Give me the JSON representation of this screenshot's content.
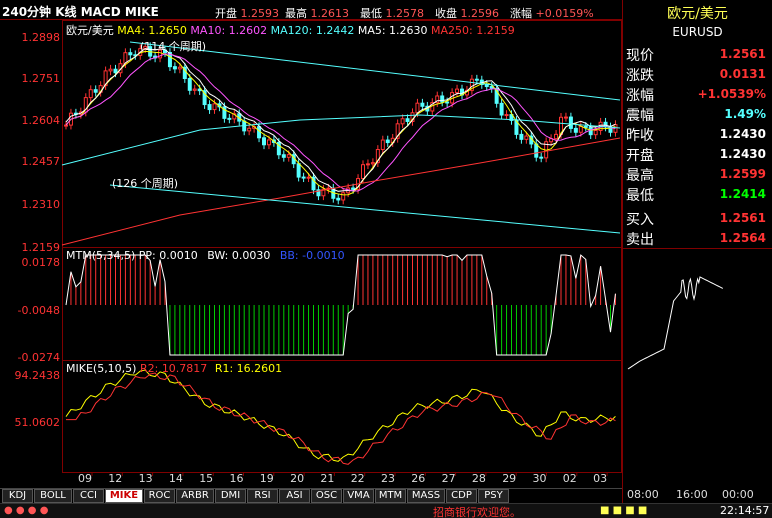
{
  "header": {
    "title": "240分钟 K线 MACD MIKE",
    "quotes": [
      {
        "label": "开盘",
        "value": "1.2593"
      },
      {
        "label": "最高",
        "value": "1.2613"
      },
      {
        "label": "最低",
        "value": "1.2578"
      },
      {
        "label": "收盘",
        "value": "1.2596"
      },
      {
        "label": "涨幅",
        "value": "+0.0159%"
      }
    ]
  },
  "kline": {
    "name": "欧元/美元",
    "ma": [
      {
        "label": "MA4: 1.2650",
        "color": "#ffff00"
      },
      {
        "label": "MA10: 1.2602",
        "color": "#ff55ff"
      },
      {
        "label": "MA120: 1.2442",
        "color": "#55ffff"
      },
      {
        "label": "MA5: 1.2630",
        "color": "#ffffff"
      },
      {
        "label": "MA250: 1.2159",
        "color": "#ff3333"
      }
    ],
    "yticks": [
      "1.2898",
      "1.2751",
      "1.2604",
      "1.2457",
      "1.2310",
      "1.2159"
    ],
    "annotations": [
      "(114 个周期)",
      "(126 个周期)"
    ]
  },
  "mtm": {
    "legend": "MTM(5,34,5)",
    "pp": "PP: 0.0010",
    "bw": "BW: 0.0030",
    "bb": "BB: -0.0010",
    "yticks": [
      "0.0178",
      "-0.0048",
      "-0.0274"
    ]
  },
  "mike": {
    "legend": "MIKE(5,10,5)",
    "r2": "R2: 10.7817",
    "r1": "R1: 16.2601",
    "yticks": [
      "94.2438",
      "51.0602"
    ]
  },
  "xaxis": [
    "09",
    "12",
    "13",
    "14",
    "15",
    "16",
    "19",
    "20",
    "21",
    "22",
    "23",
    "26",
    "27",
    "28",
    "29",
    "30",
    "02",
    "03"
  ],
  "tabs": [
    "KDJ",
    "BOLL",
    "CCI",
    "MIKE",
    "ROC",
    "ARBR",
    "DMI",
    "RSI",
    "ASI",
    "OSC",
    "VMA",
    "MTM",
    "MASS",
    "CDP",
    "PSY"
  ],
  "active_tab": "MIKE",
  "side": {
    "title": "欧元/美元",
    "code": "EURUSD",
    "rows": [
      {
        "k": "现价",
        "v": "1.2561",
        "color": "#ff3333"
      },
      {
        "k": "涨跌",
        "v": "0.0131",
        "color": "#ff3333"
      },
      {
        "k": "涨幅",
        "v": "+1.0539%",
        "color": "#ff3333"
      },
      {
        "k": "震幅",
        "v": "1.49%",
        "color": "#55ffff"
      },
      {
        "k": "昨收",
        "v": "1.2430",
        "color": "#ffffff"
      },
      {
        "k": "开盘",
        "v": "1.2430",
        "color": "#ffffff"
      },
      {
        "k": "最高",
        "v": "1.2599",
        "color": "#ff3333"
      },
      {
        "k": "最低",
        "v": "1.2414",
        "color": "#00ff00"
      },
      {
        "k": "买入",
        "v": "1.2561",
        "color": "#ff3333"
      },
      {
        "k": "卖出",
        "v": "1.2564",
        "color": "#ff3333"
      }
    ],
    "times": [
      "08:00",
      "16:00",
      "00:00"
    ]
  },
  "status": {
    "marquee": "招商银行欢迎您。",
    "time": "22:14:57"
  }
}
